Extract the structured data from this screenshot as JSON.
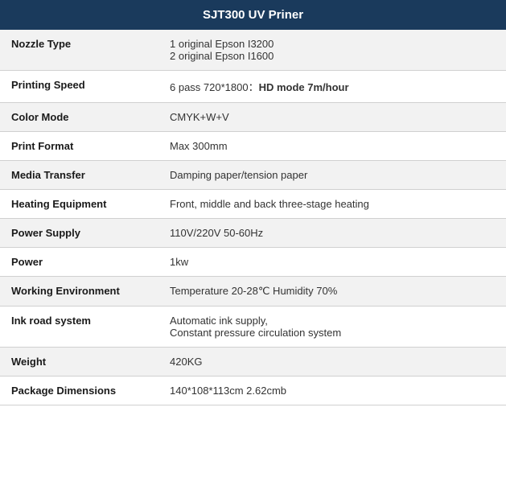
{
  "header": {
    "title": "SJT300 UV Priner"
  },
  "rows": [
    {
      "label": "Nozzle Type",
      "value": "1 original Epson I3200\n2 original Epson I1600",
      "hasHtml": false
    },
    {
      "label": "Printing Speed",
      "value": "6 pass 720*1800：",
      "valueBold": "HD mode 7m/hour",
      "hasHtml": true
    },
    {
      "label": "Color Mode",
      "value": "CMYK+W+V",
      "hasHtml": false
    },
    {
      "label": "Print Format",
      "value": "Max 300mm",
      "hasHtml": false
    },
    {
      "label": "Media Transfer",
      "value": "Damping paper/tension paper",
      "hasHtml": false
    },
    {
      "label": "Heating Equipment",
      "value": "Front, middle and back three-stage heating",
      "hasHtml": false
    },
    {
      "label": "Power Supply",
      "value": "110V/220V 50-60Hz",
      "hasHtml": false
    },
    {
      "label": "Power",
      "value": "1kw",
      "hasHtml": false
    },
    {
      "label": "Working Environment",
      "value": "Temperature 20-28℃ Humidity 70%",
      "hasHtml": false
    },
    {
      "label": "Ink road system",
      "value": "Automatic ink supply,\nConstant pressure circulation system",
      "hasHtml": false
    },
    {
      "label": "Weight",
      "value": "420KG",
      "hasHtml": false
    },
    {
      "label": "Package Dimensions",
      "value": "140*108*113cm 2.62cmb",
      "hasHtml": false
    }
  ]
}
